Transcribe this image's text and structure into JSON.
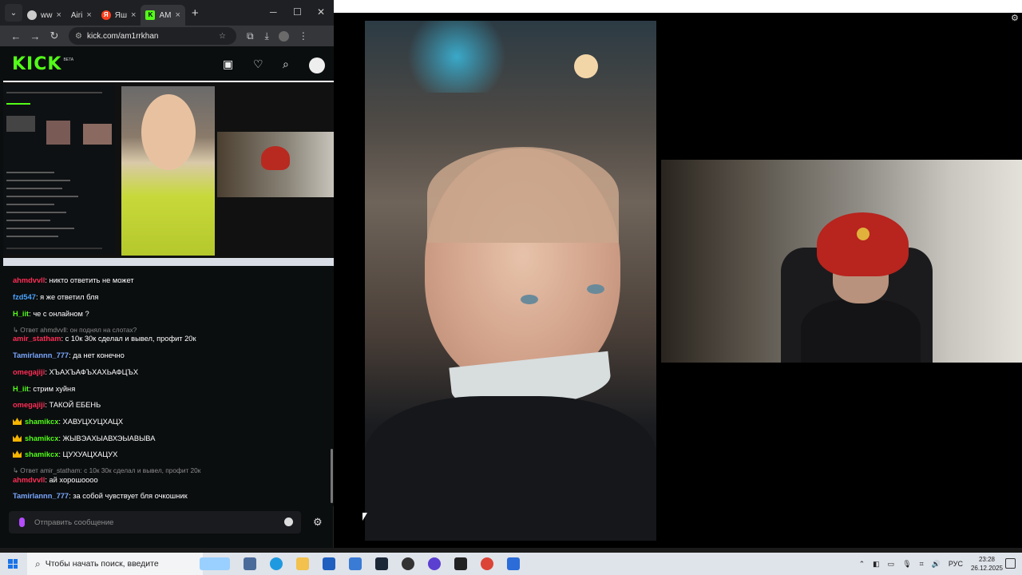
{
  "browser": {
    "tabs": [
      {
        "label": "ww",
        "icon": "globe-icon",
        "active": false
      },
      {
        "label": "Airi",
        "icon": "airi-icon",
        "active": false
      },
      {
        "label": "Яш",
        "icon": "yandex-icon",
        "active": false
      },
      {
        "label": "AM",
        "icon": "kick-icon",
        "active": true
      }
    ],
    "url": "kick.com/am1rrkhan"
  },
  "kick": {
    "logo": "KICK",
    "beta": "BETA"
  },
  "chat": {
    "messages": [
      {
        "type": "msg",
        "user": "ahmdvvll",
        "color": "#ff2d55",
        "text": ": никто ответить не может"
      },
      {
        "type": "msg",
        "user": "fzd547",
        "color": "#4aa3ff",
        "text": ": я же ответил бля"
      },
      {
        "type": "msg",
        "user": "H_iit",
        "color": "#53fc18",
        "text": ": че с онлайном ?"
      },
      {
        "type": "reply",
        "text": "Ответ ahmdvvll: он поднял на слотах?"
      },
      {
        "type": "msg",
        "user": "amir_statham",
        "color": "#ff2d55",
        "text": ": с 10к 30к сделал и вывел, профит 20к"
      },
      {
        "type": "msg",
        "user": "Tamirlannn_777",
        "color": "#7aa7ff",
        "text": ": да нет конечно"
      },
      {
        "type": "msg",
        "user": "omegajiji",
        "color": "#ff2d55",
        "text": ": ХЪАХЪАФЪХАХЬАФЦЪХ"
      },
      {
        "type": "msg",
        "user": "H_iit",
        "color": "#53fc18",
        "text": ": стрим хуйня"
      },
      {
        "type": "msg",
        "user": "omegajiji",
        "color": "#ff2d55",
        "text": ": ТАКОЙ ЕБЕНЬ"
      },
      {
        "type": "msg",
        "user": "shamikcx",
        "color": "#53fc18",
        "text": ": ХАВУЦХУЦХАЦХ",
        "badge": true
      },
      {
        "type": "msg",
        "user": "shamikcx",
        "color": "#53fc18",
        "text": ": ЖЫВЭАХЫАВХЭЫАВЫВА",
        "badge": true
      },
      {
        "type": "msg",
        "user": "shamikcx",
        "color": "#53fc18",
        "text": ": ЦУХУАЦХАЦУХ",
        "badge": true
      },
      {
        "type": "reply",
        "text": "Ответ amir_statham: с 10к 30к сделал и вывел, профит 20к"
      },
      {
        "type": "msg",
        "user": "ahmdvvll",
        "color": "#ff2d55",
        "text": ": ай хорошоооо"
      },
      {
        "type": "msg",
        "user": "Tamirlannn_777",
        "color": "#7aa7ff",
        "text": ": за собой чувствует бля очкошник"
      }
    ],
    "input_placeholder": "Отправить сообщение"
  },
  "taskbar": {
    "search_placeholder": "Чтобы начать поиск, введите",
    "lang": "РУС",
    "time": "23:28",
    "date": "26.12.2025"
  }
}
